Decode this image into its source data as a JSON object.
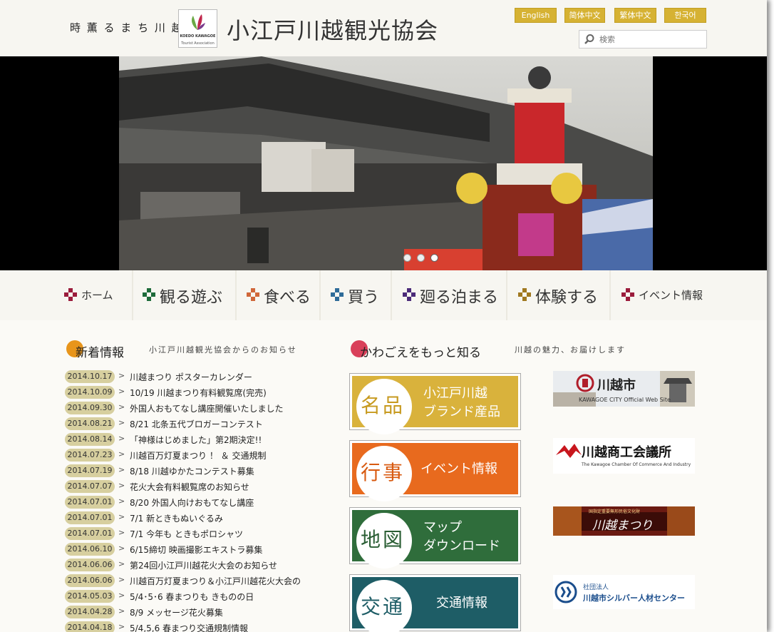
{
  "header": {
    "tagline": "時 薫 る ま ち 川 越",
    "logo_text": "KOEDO KAWAGOE",
    "logo_sub": "Tourist Association",
    "title": "小江戸川越観光協会",
    "languages": [
      "English",
      "简体中文",
      "繁体中文",
      "한국어"
    ],
    "search_placeholder": "検索"
  },
  "banner": {
    "slides": 3,
    "active_slide": 3
  },
  "nav": {
    "items": [
      {
        "label": "ホーム",
        "color": "#9b1c3c"
      },
      {
        "label": "観る遊ぶ",
        "color": "#1d6b3a"
      },
      {
        "label": "食べる",
        "color": "#d0673a"
      },
      {
        "label": "買う",
        "color": "#2f6c99"
      },
      {
        "label": "廻る泊まる",
        "color": "#4b2b79"
      },
      {
        "label": "体験する",
        "color": "#a0781f"
      },
      {
        "label": "イベント情報",
        "color": "#9b1c3c"
      }
    ]
  },
  "news": {
    "title": "新着情報",
    "subtitle": "小江戸川越観光協会からのお知らせ",
    "icon_color": "#e8951b",
    "items": [
      {
        "date": "2014.10.17",
        "text": "川越まつり ポスターカレンダー"
      },
      {
        "date": "2014.10.09",
        "text": "10/19 川越まつり有料観覧席(完売)"
      },
      {
        "date": "2014.09.30",
        "text": "外国人おもてなし講座開催いたしました"
      },
      {
        "date": "2014.08.21",
        "text": "8/21 北条五代ブロガーコンテスト"
      },
      {
        "date": "2014.08.14",
        "text": "「神様はじめました」第2期決定!!"
      },
      {
        "date": "2014.07.23",
        "text": "川越百万灯夏まつり ！ ＆ 交通規制"
      },
      {
        "date": "2014.07.19",
        "text": "8/18 川越ゆかたコンテスト募集"
      },
      {
        "date": "2014.07.07",
        "text": "花火大会有料観覧席のお知らせ"
      },
      {
        "date": "2014.07.01",
        "text": "8/20 外国人向けおもてなし講座"
      },
      {
        "date": "2014.07.01",
        "text": "7/1 新ときもぬいぐるみ"
      },
      {
        "date": "2014.07.01",
        "text": "7/1 今年も ときもポロシャツ"
      },
      {
        "date": "2014.06.10",
        "text": "6/15締切 映画撮影エキストラ募集"
      },
      {
        "date": "2014.06.06",
        "text": "第24回小江戸川越花火大会のお知らせ"
      },
      {
        "date": "2014.06.06",
        "text": "川越百万灯夏まつり＆小江戸川越花火大会の"
      },
      {
        "date": "2014.05.03",
        "text": "5/4･5･6 春まつりも きものの日"
      },
      {
        "date": "2014.04.28",
        "text": "8/9 メッセージ花火募集"
      },
      {
        "date": "2014.04.18",
        "text": "5/4,5,6 春まつり交通規制情報"
      }
    ]
  },
  "know": {
    "title": "かわごえをもっと知る",
    "subtitle": "川越の魅力、お届けします",
    "icon_color": "#d9405a",
    "buttons": [
      {
        "big": "名品",
        "lines": [
          "小江戸川越",
          "ブランド産品"
        ],
        "color": "#d9b23c",
        "big_color": "#c79a1f"
      },
      {
        "big": "行事",
        "lines": [
          "イベント情報"
        ],
        "color": "#e86a1e",
        "big_color": "#d85a10"
      },
      {
        "big": "地図",
        "lines": [
          "マップ",
          "ダウンロード"
        ],
        "color": "#2f6d3b",
        "big_color": "#2a5e34"
      },
      {
        "big": "交通",
        "lines": [
          "交通情報"
        ],
        "color": "#1e5d66",
        "big_color": "#1e5d66"
      }
    ]
  },
  "ads": [
    {
      "title": "川越市",
      "sub": "KAWAGOE CITY Official Web Site"
    },
    {
      "title": "川越商工会議所",
      "sub": "The Kawagoe Chamber Of Commerce And Industry"
    },
    {
      "title": "川越まつり",
      "sub": "国指定重要無形民俗文化財"
    },
    {
      "title": "川越市シルバー人材センター",
      "sub": "社団法人"
    }
  ]
}
